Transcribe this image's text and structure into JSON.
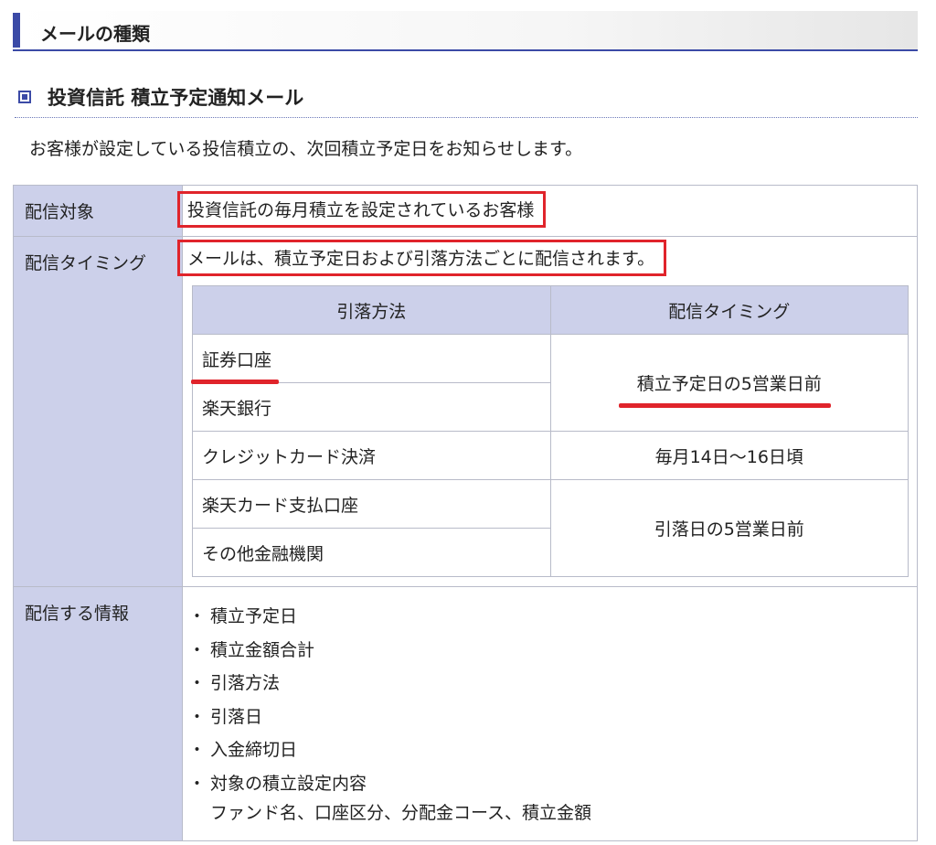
{
  "section": {
    "title": "メールの種類"
  },
  "subsection": {
    "title": "投資信託 積立予定通知メール"
  },
  "description": "お客様が設定している投信積立の、次回積立予定日をお知らせします。",
  "rows": {
    "target": {
      "label": "配信対象",
      "value": "投資信託の毎月積立を設定されているお客様"
    },
    "timing": {
      "label": "配信タイミング",
      "note": "メールは、積立予定日および引落方法ごとに配信されます。",
      "table": {
        "headers": [
          "引落方法",
          "配信タイミング"
        ],
        "methods": [
          "証券口座",
          "楽天銀行",
          "クレジットカード決済",
          "楽天カード支払口座",
          "その他金融機関"
        ],
        "timings": [
          "積立予定日の5営業日前",
          "毎月14日〜16日頃",
          "引落日の5営業日前"
        ]
      }
    },
    "info": {
      "label": "配信する情報",
      "bullet": "・",
      "items": [
        "積立予定日",
        "積立金額合計",
        "引落方法",
        "引落日",
        "入金締切日",
        "対象の積立設定内容"
      ],
      "sub": "ファンド名、口座区分、分配金コース、積立金額"
    }
  },
  "colors": {
    "accent": "#3b4aa6",
    "header_bg": "#ccd0ea",
    "highlight": "#e0242b"
  }
}
